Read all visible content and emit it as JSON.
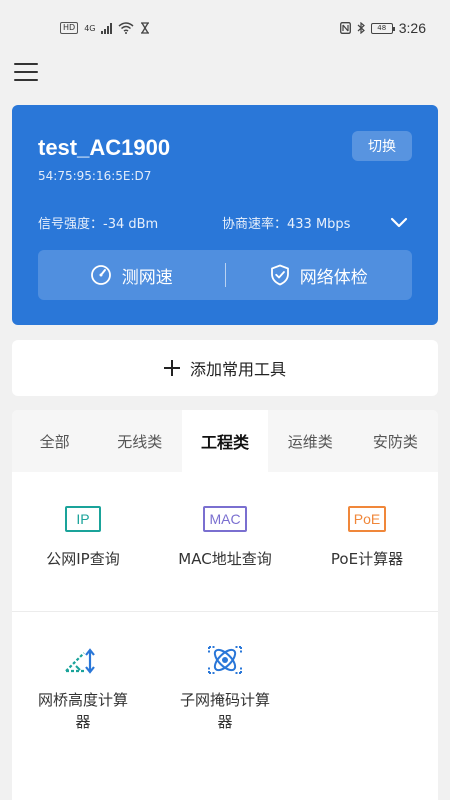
{
  "status_bar": {
    "left_badge": "HD",
    "network_type": "4G",
    "battery_level": "48",
    "time": "3:26"
  },
  "device": {
    "name": "test_AC1900",
    "mac": "54:75:95:16:5E:D7",
    "switch_label": "切换",
    "signal_text": "信号强度：-34 dBm",
    "rate_text": "协商速率：433 Mbps",
    "actions": {
      "speed_test": "测网速",
      "network_check": "网络体检"
    }
  },
  "add_tool_label": "添加常用工具",
  "tabs": [
    {
      "label": "全部",
      "active": false
    },
    {
      "label": "无线类",
      "active": false
    },
    {
      "label": "工程类",
      "active": true
    },
    {
      "label": "运维类",
      "active": false
    },
    {
      "label": "安防类",
      "active": false
    }
  ],
  "tools": [
    {
      "label": "公网IP查询",
      "icon": "ip-icon",
      "icon_text": "IP",
      "color": "#1aa39a"
    },
    {
      "label": "MAC地址查询",
      "icon": "mac-icon",
      "icon_text": "MAC",
      "color": "#7a6fd0"
    },
    {
      "label": "PoE计算器",
      "icon": "poe-icon",
      "icon_text": "PoE",
      "color": "#f0873a"
    },
    {
      "label": "网桥高度计算器",
      "icon": "bridge-height-icon",
      "color": "#1aa39a"
    },
    {
      "label": "子网掩码计算器",
      "icon": "subnet-mask-icon",
      "color": "#2a77d8"
    }
  ],
  "colors": {
    "accent": "#2a77d8",
    "background": "#f1f1f1"
  }
}
